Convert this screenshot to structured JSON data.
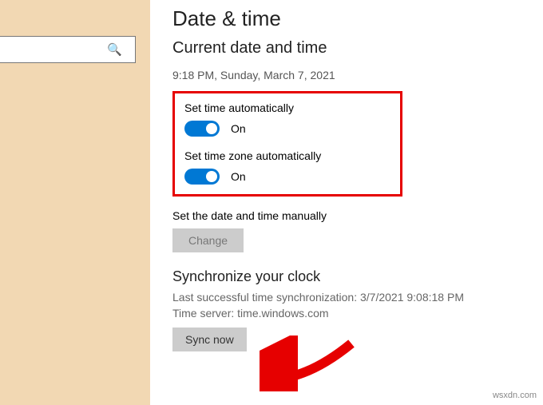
{
  "page": {
    "title": "Date & time",
    "subtitle": "Current date and time",
    "timestamp": "9:18 PM, Sunday, March 7, 2021"
  },
  "set_time_auto": {
    "label": "Set time automatically",
    "state": "On"
  },
  "set_tz_auto": {
    "label": "Set time zone automatically",
    "state": "On"
  },
  "manual": {
    "label": "Set the date and time manually",
    "button": "Change"
  },
  "sync": {
    "heading": "Synchronize your clock",
    "last": "Last successful time synchronization: 3/7/2021 9:08:18 PM",
    "server": "Time server: time.windows.com",
    "button": "Sync now"
  },
  "watermark": "wsxdn.com"
}
